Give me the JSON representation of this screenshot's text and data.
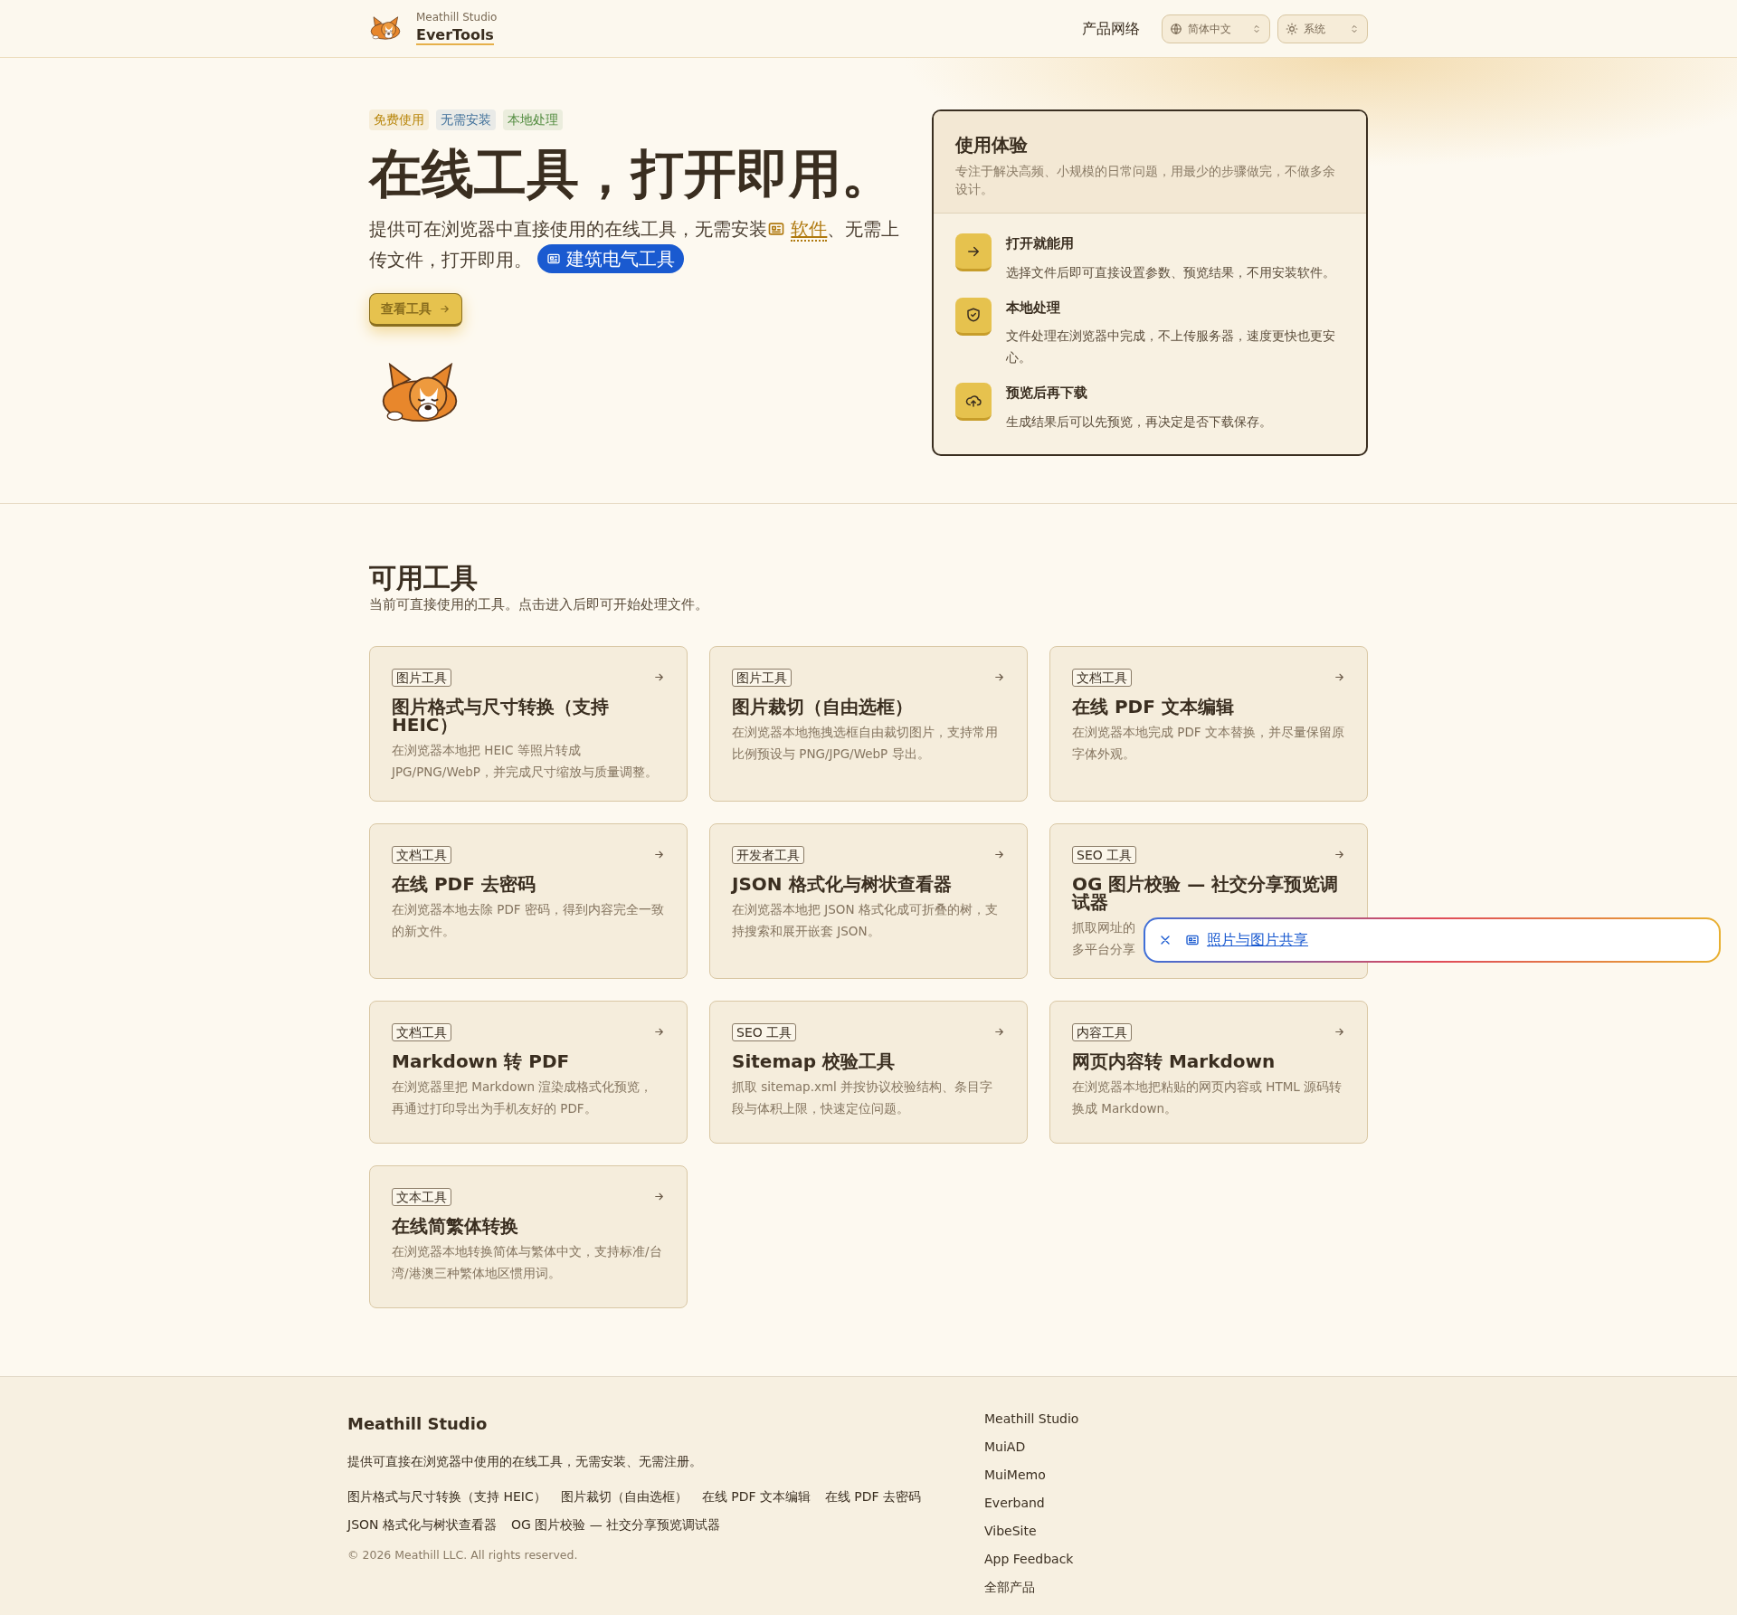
{
  "header": {
    "brand_small": "Meathill Studio",
    "brand_name": "EverTools",
    "nav_link": "产品网络",
    "language_select": {
      "value": "简体中文"
    },
    "theme_select": {
      "value": "系统"
    }
  },
  "hero": {
    "tags": [
      {
        "label": "免费使用",
        "color": "#b8860b"
      },
      {
        "label": "无需安装",
        "color": "#3f6f9a"
      },
      {
        "label": "本地处理",
        "color": "#4f8a3c"
      }
    ],
    "title": "在线工具，打开即用。",
    "intro_before": "提供可在浏览器中直接使用的在线工具，无需安装",
    "intro_link": "软件",
    "intro_after": "、无需上传文件，打开即用。",
    "chip": "建筑电气工具",
    "button": "查看工具"
  },
  "experience": {
    "title": "使用体验",
    "subtitle": "专注于解决高频、小规模的日常问题，用最少的步骤做完，不做多余设计。",
    "items": [
      {
        "kind": "arrow",
        "title": "打开就能用",
        "text": "选择文件后即可直接设置参数、预览结果，不用安装软件。"
      },
      {
        "kind": "shield",
        "title": "本地处理",
        "text": "文件处理在浏览器中完成，不上传服务器，速度更快也更安心。"
      },
      {
        "kind": "upload",
        "title": "预览后再下载",
        "text": "生成结果后可以先预览，再决定是否下载保存。"
      }
    ]
  },
  "tools": {
    "heading": "可用工具",
    "subheading": "当前可直接使用的工具。点击进入后即可开始处理文件。",
    "cards": [
      {
        "tag": "图片工具",
        "title": "图片格式与尺寸转换（支持 HEIC）",
        "desc": [
          "在浏览器本地把 HEIC 等照片转成 JPG/PNG/WebP，并完成尺寸缩放与质量调整。"
        ]
      },
      {
        "tag": "图片工具",
        "title": "图片裁切（自由选框）",
        "desc": [
          "在浏览器本地拖拽选框自由裁切图片，支持常用比例预设与 PNG/JPG/WebP 导出。"
        ]
      },
      {
        "tag": "文档工具",
        "title": "在线 PDF 文本编辑",
        "desc": [
          "在浏览器本地完成 PDF 文本替换，并尽量保留原字体外观。"
        ]
      },
      {
        "tag": "文档工具",
        "title": "在线 PDF 去密码",
        "desc": [
          "在浏览器本地去除 PDF 密码，得到内容完全一致的新文件。"
        ]
      },
      {
        "tag": "开发者工具",
        "title": "JSON 格式化与树状查看器",
        "desc": [
          "在浏览器本地把 JSON 格式化成可折叠的树，支持搜索和展开嵌套 JSON。"
        ]
      },
      {
        "tag": "SEO 工具",
        "title": "OG 图片校验 — 社交分享预览调试器",
        "desc": [
          "抓取网址的",
          "多平台分享"
        ]
      },
      {
        "tag": "文档工具",
        "title": "Markdown 转 PDF",
        "desc": [
          "在浏览器里把 Markdown 渲染成格式化预览，再通过打印导出为手机友好的 PDF。"
        ]
      },
      {
        "tag": "SEO 工具",
        "title": "Sitemap 校验工具",
        "desc": [
          "抓取 sitemap.xml 并按协议校验结构、条目字段与体积上限，快速定位问题。"
        ]
      },
      {
        "tag": "内容工具",
        "title": "网页内容转 Markdown",
        "desc": [
          "在浏览器本地把粘贴的网页内容或 HTML 源码转换成 Markdown。"
        ]
      },
      {
        "tag": "文本工具",
        "title": "在线简繁体转换",
        "desc": [
          "在浏览器本地转换简体与繁体中文，支持标准/台湾/港澳三种繁体地区惯用词。"
        ]
      }
    ]
  },
  "popup": {
    "text": "照片与图片共享"
  },
  "footer": {
    "brand": "Meathill Studio",
    "tagline": "提供可直接在浏览器中使用的在线工具，无需安装、无需注册。",
    "links": [
      "图片格式与尺寸转换（支持 HEIC）",
      "图片裁切（自由选框）",
      "在线 PDF 文本编辑",
      "在线 PDF 去密码",
      "JSON 格式化与树状查看器",
      "OG 图片校验 — 社交分享预览调试器"
    ],
    "copyright": "© 2026 Meathill LLC. All rights reserved.",
    "products": [
      "Meathill Studio",
      "MuiAD",
      "MuiMemo",
      "Everband",
      "VibeSite",
      "App Feedback",
      "全部产品"
    ]
  }
}
